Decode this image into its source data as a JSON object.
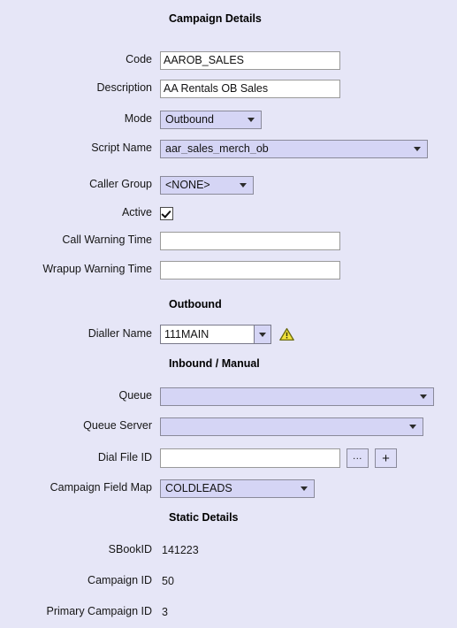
{
  "colors": {
    "page_background": "#e6e6f7",
    "input_background": "#ffffff",
    "select_background": "#d5d5f5",
    "button_background": "#dedef8",
    "border": "#8a8a9a",
    "text": "#1a1a1a",
    "warning_fill": "#f2e23c",
    "warning_stroke": "#6b6b12"
  },
  "sections": {
    "campaign_details": "Campaign Details",
    "outbound": "Outbound",
    "inbound_manual": "Inbound / Manual",
    "static_details": "Static Details"
  },
  "fields": {
    "code": {
      "label": "Code",
      "value": "AAROB_SALES",
      "placeholder": ""
    },
    "description": {
      "label": "Description",
      "value": "AA Rentals OB Sales",
      "placeholder": ""
    },
    "mode": {
      "label": "Mode",
      "value": "Outbound"
    },
    "script_name": {
      "label": "Script Name",
      "value": "aar_sales_merch_ob"
    },
    "caller_group": {
      "label": "Caller Group",
      "value": "<NONE>"
    },
    "active": {
      "label": "Active",
      "checked": true
    },
    "call_warning_time": {
      "label": "Call Warning Time",
      "value": "",
      "placeholder": ""
    },
    "wrapup_warning_time": {
      "label": "Wrapup Warning Time",
      "value": "",
      "placeholder": ""
    },
    "dialler_name": {
      "label": "Dialler Name",
      "value": "111MAIN",
      "warning_icon": "warning-triangle-icon"
    },
    "queue": {
      "label": "Queue",
      "value": ""
    },
    "queue_server": {
      "label": "Queue Server",
      "value": ""
    },
    "dial_file_id": {
      "label": "Dial File ID",
      "value": "",
      "placeholder": "",
      "browse_button": "...",
      "add_button": "+"
    },
    "campaign_field_map": {
      "label": "Campaign Field Map",
      "value": "COLDLEADS"
    }
  },
  "static_details": [
    {
      "label": "SBookID",
      "value": "141223"
    },
    {
      "label": "Campaign ID",
      "value": "50"
    },
    {
      "label": "Primary Campaign ID",
      "value": "3"
    }
  ]
}
